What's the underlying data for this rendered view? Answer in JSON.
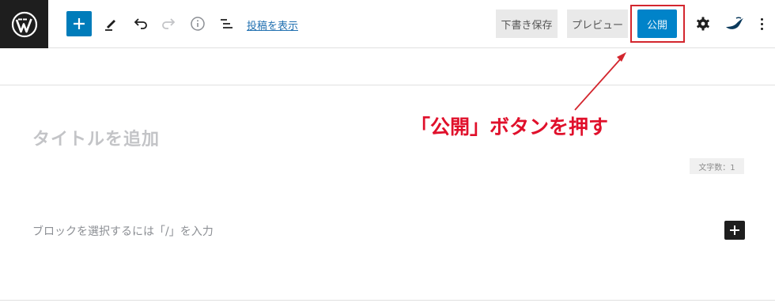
{
  "toolbar": {
    "icons": {
      "logo": "wordpress-logo",
      "add": "plus-icon",
      "edit": "pencil-icon",
      "undo": "undo-icon",
      "redo": "redo-icon",
      "info": "info-icon",
      "outline": "list-view-icon",
      "settings": "gear-icon",
      "plugin": "jetpack-icon",
      "more": "more-vertical-icon"
    },
    "view_post": "投稿を表示",
    "save_draft": "下書き保存",
    "preview": "プレビュー",
    "publish": "公開"
  },
  "editor": {
    "title_placeholder": "タイトルを追加",
    "char_count": "文字数：1",
    "block_placeholder": "ブロックを選択するには「/」を入力"
  },
  "annotation": {
    "text": "「公開」ボタンを押す",
    "color": "#e0102b"
  },
  "colors": {
    "accent": "#007cba",
    "publish": "#0083c9",
    "highlight": "#d3262e"
  }
}
